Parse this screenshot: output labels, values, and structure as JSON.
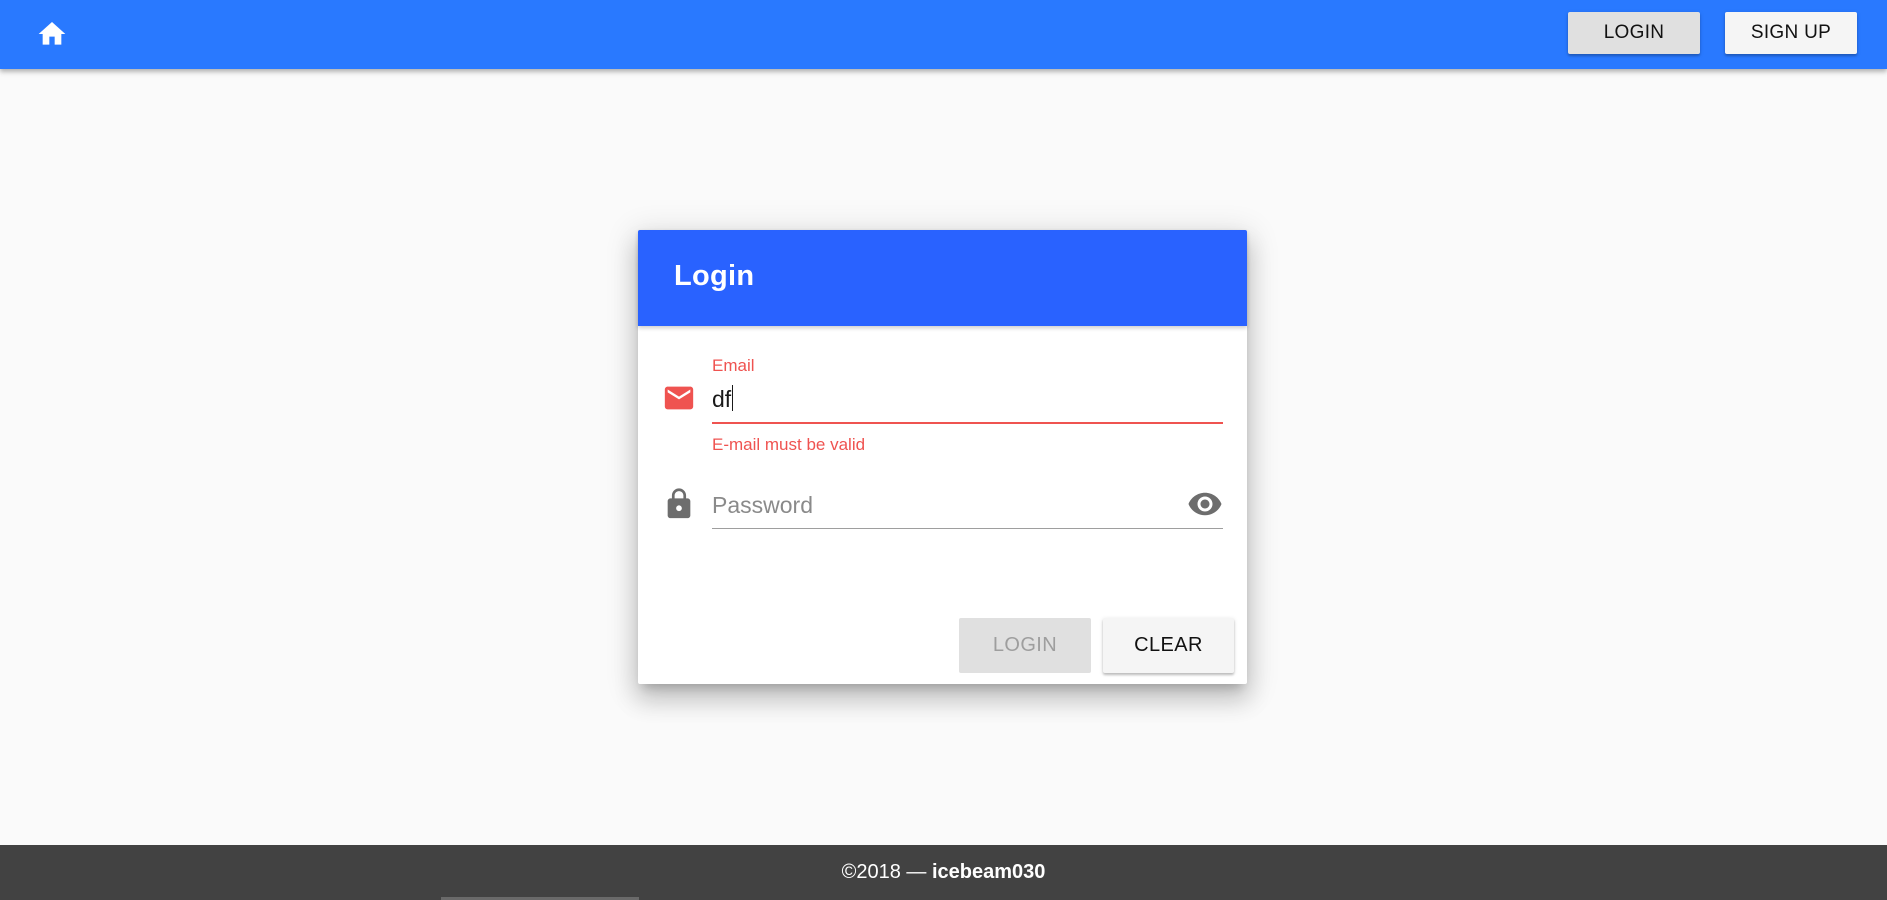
{
  "appbar": {
    "home_icon": "home-icon",
    "login_label": "LOGIN",
    "signup_label": "SIGN UP",
    "color": "#2979ff"
  },
  "login_card": {
    "title": "Login",
    "header_color": "#2962ff",
    "email": {
      "icon": "email-icon",
      "label": "Email",
      "value": "df",
      "error": "E-mail must be valid",
      "error_color": "#ef5350"
    },
    "password": {
      "icon": "lock-icon",
      "placeholder": "Password",
      "value": "",
      "toggle_icon": "eye-icon"
    },
    "login_button": "LOGIN",
    "clear_button": "CLEAR"
  },
  "footer": {
    "copyright": "©2018 — ",
    "author": "icebeam030",
    "color": "#424242"
  }
}
